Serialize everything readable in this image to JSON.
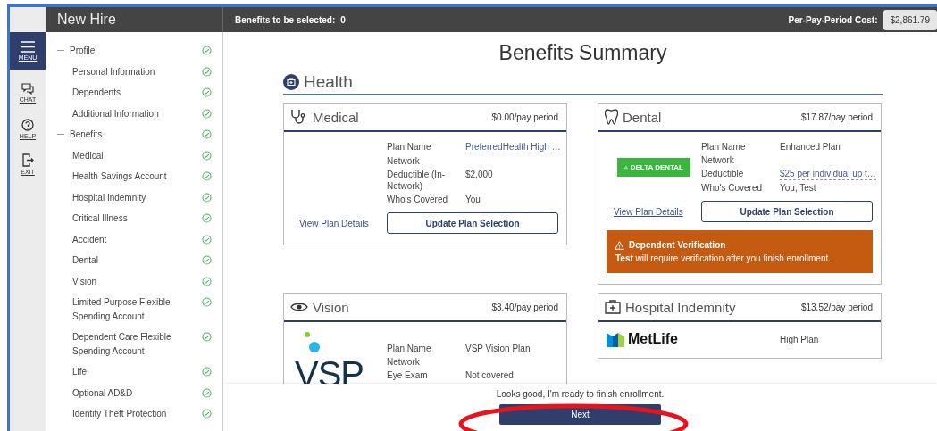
{
  "app": {
    "title": "New Hire"
  },
  "rail": [
    {
      "kind": "menu",
      "label": "MENU",
      "selected": true
    },
    {
      "kind": "chat",
      "label": "CHAT",
      "selected": false
    },
    {
      "kind": "help",
      "label": "HELP",
      "selected": false
    },
    {
      "kind": "exit",
      "label": "EXIT",
      "selected": false
    }
  ],
  "nav": [
    {
      "label": "Profile",
      "complete": true,
      "expanded": true,
      "children": [
        {
          "label": "Personal Information",
          "complete": true
        },
        {
          "label": "Dependents",
          "complete": true
        },
        {
          "label": "Additional Information",
          "complete": true
        }
      ]
    },
    {
      "label": "Benefits",
      "complete": true,
      "expanded": true,
      "children": [
        {
          "label": "Medical",
          "complete": true
        },
        {
          "label": "Health Savings Account",
          "complete": true
        },
        {
          "label": "Hospital Indemnity",
          "complete": true
        },
        {
          "label": "Critical Illness",
          "complete": true
        },
        {
          "label": "Accident",
          "complete": true
        },
        {
          "label": "Dental",
          "complete": true
        },
        {
          "label": "Vision",
          "complete": true
        },
        {
          "label": "Limited Purpose Flexible Spending Account",
          "complete": true
        },
        {
          "label": "Dependent Care Flexible Spending Account",
          "complete": true
        },
        {
          "label": "Life",
          "complete": true
        },
        {
          "label": "Optional AD&D",
          "complete": true
        },
        {
          "label": "Identity Theft Protection",
          "complete": true
        }
      ]
    }
  ],
  "topbar": {
    "benefits_label": "Benefits to be selected:",
    "benefits_count": "0",
    "cost_label": "Per-Pay-Period Cost:",
    "cost_value": "$2,861.79"
  },
  "page_title": "Benefits Summary",
  "section": {
    "title": "Health"
  },
  "cards": [
    {
      "kind": "medical",
      "title": "Medical",
      "price": "$0.00/pay period",
      "details": [
        {
          "label": "Plan Name",
          "value": "PreferredHealth High …",
          "truncated": true
        },
        {
          "label": "Network"
        },
        {
          "label": "Deductible (In-Network)",
          "value": "$2,000",
          "truncated": false
        },
        {
          "label": "Who's Covered",
          "value": "You",
          "truncated": false
        }
      ],
      "link": "View Plan Details",
      "button": "Update Plan Selection"
    },
    {
      "kind": "dental",
      "title": "Dental",
      "price": "$17.87/pay period",
      "logo": {
        "kind": "delta",
        "text": "DELTA DENTAL"
      },
      "details": [
        {
          "label": "Plan Name",
          "value": "Enhanced Plan",
          "truncated": false
        },
        {
          "label": "Network"
        },
        {
          "label": "Deductible",
          "value": "$25 per individual up t…",
          "truncated": true
        },
        {
          "label": "Who's Covered",
          "value": "You, Test",
          "truncated": false
        }
      ],
      "link": "View Plan Details",
      "button": "Update Plan Selection",
      "alert": {
        "title": "Dependent Verification",
        "text": "**Test** will require verification after you finish enrollment."
      }
    },
    {
      "kind": "vision",
      "title": "Vision",
      "price": "$3.40/pay period",
      "logo": {
        "kind": "vsp",
        "text": "VSP"
      },
      "details": [
        {
          "label": "Plan Name",
          "value": "VSP Vision Plan",
          "truncated": false
        },
        {
          "label": "Network"
        },
        {
          "label": "Eye Exam",
          "value": "Not covered",
          "truncated": false
        }
      ]
    },
    {
      "kind": "hospital",
      "title": "Hospital Indemnity",
      "price": "$13.52/pay period",
      "logo": {
        "kind": "metlife",
        "text": "MetLife"
      },
      "details": [
        {
          "value": "High Plan",
          "truncated": false
        }
      ]
    }
  ],
  "footer": {
    "message": "Looks good, I'm ready to finish enrollment.",
    "button": "Next"
  }
}
